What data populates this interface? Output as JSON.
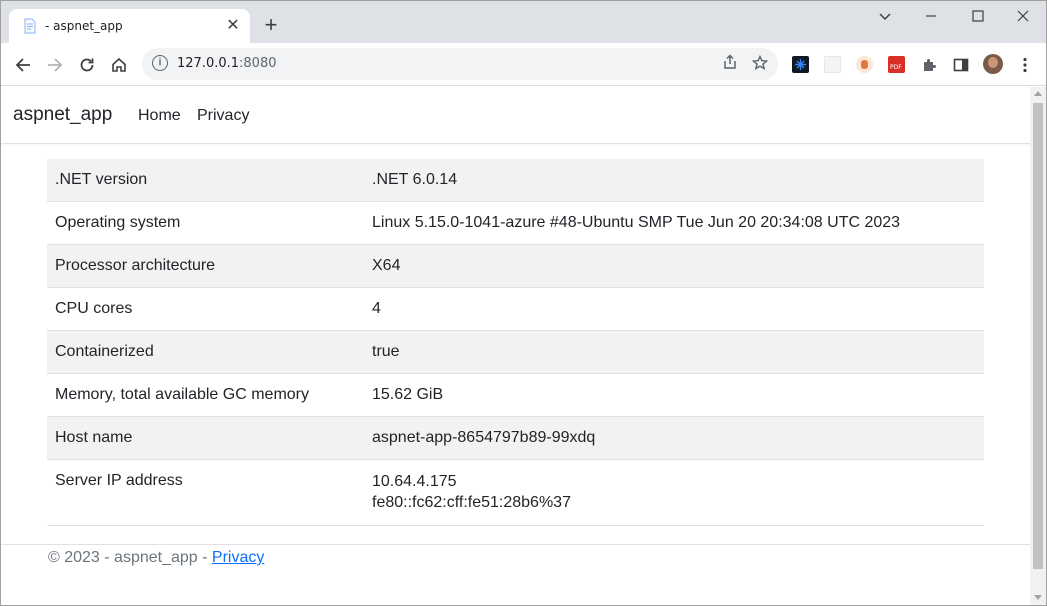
{
  "browser": {
    "tab_title": "- aspnet_app",
    "url_host": "127.0.0.1",
    "url_port": ":8080"
  },
  "page": {
    "brand": "aspnet_app",
    "nav": [
      {
        "label": "Home"
      },
      {
        "label": "Privacy"
      }
    ],
    "rows": [
      {
        "key": ".NET version",
        "value": ".NET 6.0.14"
      },
      {
        "key": "Operating system",
        "value": "Linux 5.15.0-1041-azure #48-Ubuntu SMP Tue Jun 20 20:34:08 UTC 2023"
      },
      {
        "key": "Processor architecture",
        "value": "X64"
      },
      {
        "key": "CPU cores",
        "value": "4"
      },
      {
        "key": "Containerized",
        "value": "true"
      },
      {
        "key": "Memory, total available GC memory",
        "value": "15.62 GiB"
      },
      {
        "key": "Host name",
        "value": "aspnet-app-8654797b89-99xdq"
      },
      {
        "key": "Server IP address",
        "values": [
          "10.64.4.175",
          "fe80::fc62:cff:fe51:28b6%37"
        ]
      }
    ],
    "footer": {
      "prefix": "© 2023 - aspnet_app - ",
      "link": "Privacy"
    }
  },
  "colors": {
    "tabstrip": "#dee1e6",
    "stripe": "#f2f2f2",
    "link": "#0d6efd",
    "muted": "#6c757d"
  }
}
